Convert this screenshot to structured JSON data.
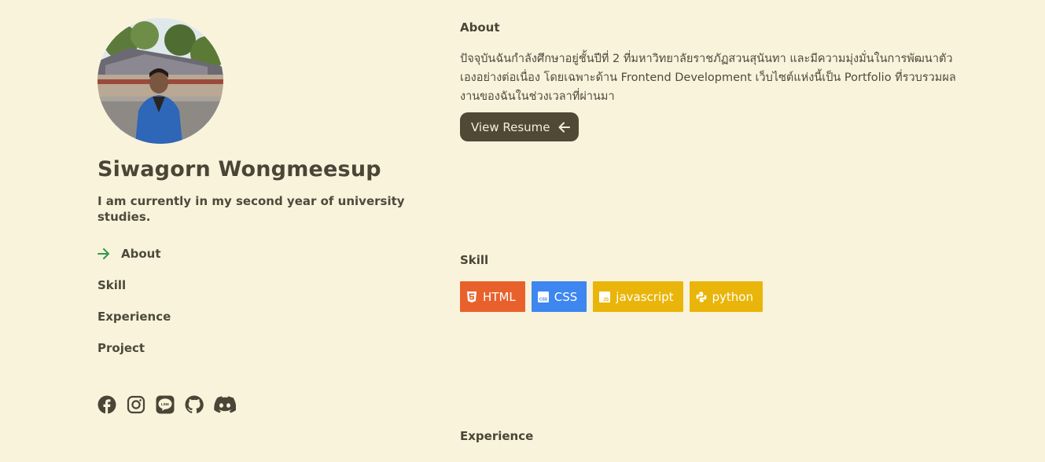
{
  "profile": {
    "name": "Siwagorn Wongmeesup",
    "tagline": "I am currently in my second year of university studies."
  },
  "nav": {
    "items": [
      {
        "label": "About",
        "active": true
      },
      {
        "label": "Skill",
        "active": false
      },
      {
        "label": "Experience",
        "active": false
      },
      {
        "label": "Project",
        "active": false
      }
    ],
    "active_arrow_icon": "arrow-right-icon"
  },
  "socials": [
    {
      "icon": "facebook-icon"
    },
    {
      "icon": "instagram-icon"
    },
    {
      "icon": "line-icon"
    },
    {
      "icon": "github-icon"
    },
    {
      "icon": "discord-icon"
    }
  ],
  "about": {
    "heading": "About",
    "text": "ปัจจุบันฉันกำลังศึกษาอยู่ชั้นปีที่ 2 ที่มหาวิทยาลัยราชภัฏสวนสุนันทา และมีความมุ่งมั่นในการพัฒนาตัวเองอย่างต่อเนื่อง โดยเฉพาะด้าน Frontend Development เว็บไซต์แห่งนี้เป็น Portfolio ที่รวบรวมผลงานของฉันในช่วงเวลาที่ผ่านมา",
    "resume_button": "View Resume",
    "resume_icon": "arrow-left-icon"
  },
  "skill": {
    "heading": "Skill",
    "items": [
      {
        "label": "HTML",
        "icon": "html5-icon",
        "color": "#e8612c"
      },
      {
        "label": "CSS",
        "icon": "css3-icon",
        "color": "#3e86f0"
      },
      {
        "label": "javascript",
        "icon": "javascript-icon",
        "color": "#e9b50a"
      },
      {
        "label": "python",
        "icon": "python-icon",
        "color": "#e9b50a"
      }
    ]
  },
  "experience": {
    "heading": "Experience"
  },
  "colors": {
    "background": "#faf3dc",
    "text": "#4a4536",
    "button": "#4f4935",
    "active_arrow": "#2e9b4f"
  }
}
